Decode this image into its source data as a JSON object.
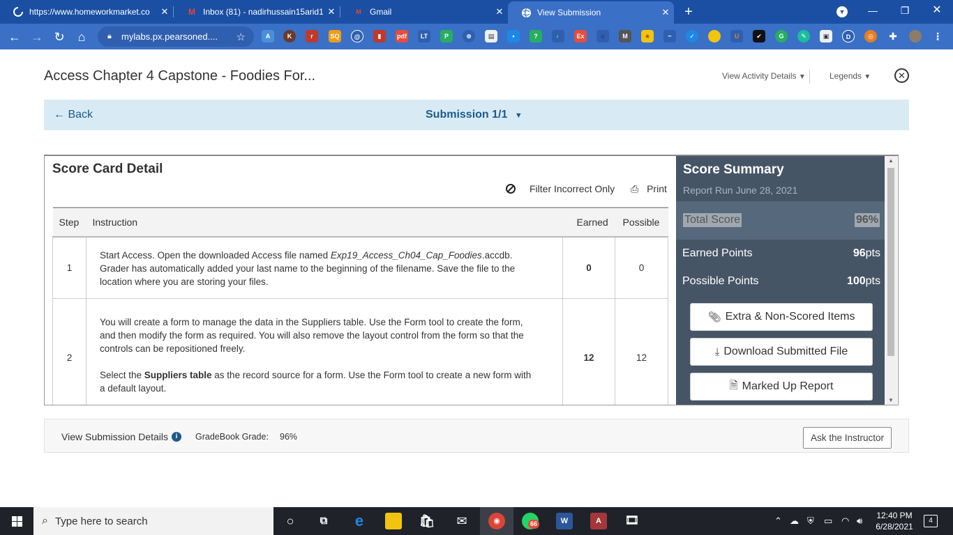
{
  "browser": {
    "tabs": [
      {
        "label": "https://www.homeworkmarket.co",
        "icon": "spinner-icon"
      },
      {
        "label": "Inbox (81) - nadirhussain15arid1",
        "icon": "gmail-icon"
      },
      {
        "label": "Gmail",
        "icon": "gmail-icon"
      },
      {
        "label": "View Submission",
        "icon": "globe-icon"
      }
    ],
    "url": "mylabs.px.pearsoned...."
  },
  "header": {
    "title": "Access Chapter 4 Capstone - Foodies For...",
    "view_activity_details": "View Activity Details",
    "legends": "Legends"
  },
  "subbar": {
    "back": "Back",
    "submission": "Submission 1/1"
  },
  "score_card": {
    "title": "Score Card Detail",
    "filter": "Filter Incorrect Only",
    "print": "Print",
    "columns": {
      "step": "Step",
      "instruction": "Instruction",
      "earned": "Earned",
      "possible": "Possible"
    },
    "rows": [
      {
        "step": "1",
        "instruction_a": "Start Access. Open the downloaded Access file named ",
        "instruction_file": "Exp19_Access_Ch04_Cap_Foodies",
        "instruction_b": ".accdb. Grader has automatically added your last name to the beginning of the filename. Save the file to the location where you are storing your files.",
        "earned": "0",
        "possible": "0"
      },
      {
        "step": "2",
        "instruction_a": "You will create a form to manage the data in the Suppliers table. Use the Form tool to create the form, and then modify the form as required. You will also remove the layout control from the form so that the controls can be repositioned freely.",
        "instruction_b_pre": "Select the ",
        "instruction_b_bold": "Suppliers table",
        "instruction_b_post": " as the record source for a form. Use the Form tool to create a new form with a default layout.",
        "earned": "12",
        "possible": "12"
      }
    ]
  },
  "summary": {
    "title": "Score Summary",
    "report_run": "Report Run June 28, 2021",
    "total_label": "Total Score",
    "total_value": "96%",
    "earned_label": "Earned Points",
    "earned_value": "96",
    "possible_label": "Possible Points",
    "possible_value": "100",
    "pts_unit": "pts",
    "buttons": {
      "extra": "Extra & Non-Scored Items",
      "download": "Download Submitted File",
      "marked": "Marked Up Report"
    }
  },
  "footer": {
    "details": "View Submission Details",
    "grade_label": "GradeBook Grade:",
    "grade_value": "96%",
    "ask": "Ask the Instructor"
  },
  "taskbar": {
    "search_placeholder": "Type here to search",
    "whatsapp_badge": "66",
    "time": "12:40 PM",
    "date": "6/28/2021",
    "notifications": "4"
  }
}
